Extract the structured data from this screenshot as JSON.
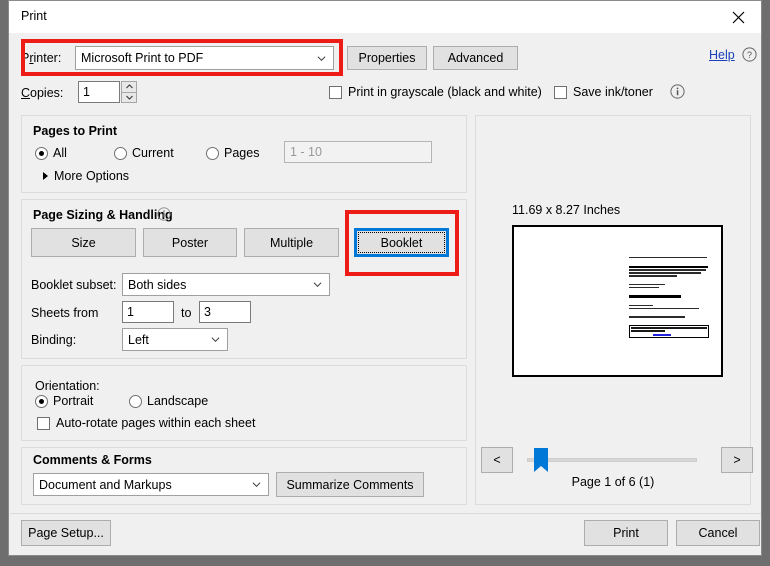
{
  "window": {
    "title": "Print",
    "close_icon": "close-icon"
  },
  "printer": {
    "label": "Printer:",
    "value": "Microsoft Print to PDF",
    "properties_label": "Properties",
    "advanced_label": "Advanced",
    "help_label": "Help",
    "help_icon": "help-circle-icon",
    "dropdown_icon": "chevron-down-icon"
  },
  "copies": {
    "label": "Copies:",
    "value": "1",
    "spin_up_icon": "spinner-up-icon",
    "spin_down_icon": "spinner-down-icon"
  },
  "options": {
    "grayscale_label": "Print in grayscale (black and white)",
    "grayscale_checked": false,
    "save_ink_label": "Save ink/toner",
    "save_ink_checked": false,
    "info_icon": "info-circle-icon"
  },
  "pages_to_print": {
    "title": "Pages to Print",
    "radios": [
      {
        "label": "All",
        "checked": true
      },
      {
        "label": "Current",
        "checked": false
      },
      {
        "label": "Pages",
        "checked": false
      }
    ],
    "range_placeholder": "1 - 10",
    "range_value": "",
    "more_options_label": "More Options",
    "more_options_icon": "triangle-right-icon"
  },
  "page_sizing": {
    "title": "Page Sizing & Handling",
    "info_icon": "info-circle-icon",
    "buttons": [
      {
        "label": "Size",
        "selected": false
      },
      {
        "label": "Poster",
        "selected": false
      },
      {
        "label": "Multiple",
        "selected": false
      },
      {
        "label": "Booklet",
        "selected": true
      }
    ],
    "booklet_subset_label": "Booklet subset:",
    "booklet_subset_value": "Both sides",
    "sheets_from_label": "Sheets from",
    "sheets_from_value": "1",
    "sheets_to_label": "to",
    "sheets_to_value": "3",
    "binding_label": "Binding:",
    "binding_value": "Left"
  },
  "orientation": {
    "label": "Orientation:",
    "radios": [
      {
        "label": "Portrait",
        "checked": true
      },
      {
        "label": "Landscape",
        "checked": false
      }
    ],
    "auto_rotate_label": "Auto-rotate pages within each sheet",
    "auto_rotate_checked": false
  },
  "comments_forms": {
    "title": "Comments & Forms",
    "selected": "Document and Markups",
    "summarize_label": "Summarize Comments"
  },
  "preview": {
    "page_dimensions": "11.69 x 8.27 Inches",
    "prev_label": "<",
    "next_label": ">",
    "page_status": "Page 1 of 6 (1)"
  },
  "footer": {
    "page_setup_label": "Page Setup...",
    "print_label": "Print",
    "cancel_label": "Cancel"
  },
  "annotations": {
    "highlight_color": "#ee1c16",
    "focus_color": "#0078d7"
  }
}
